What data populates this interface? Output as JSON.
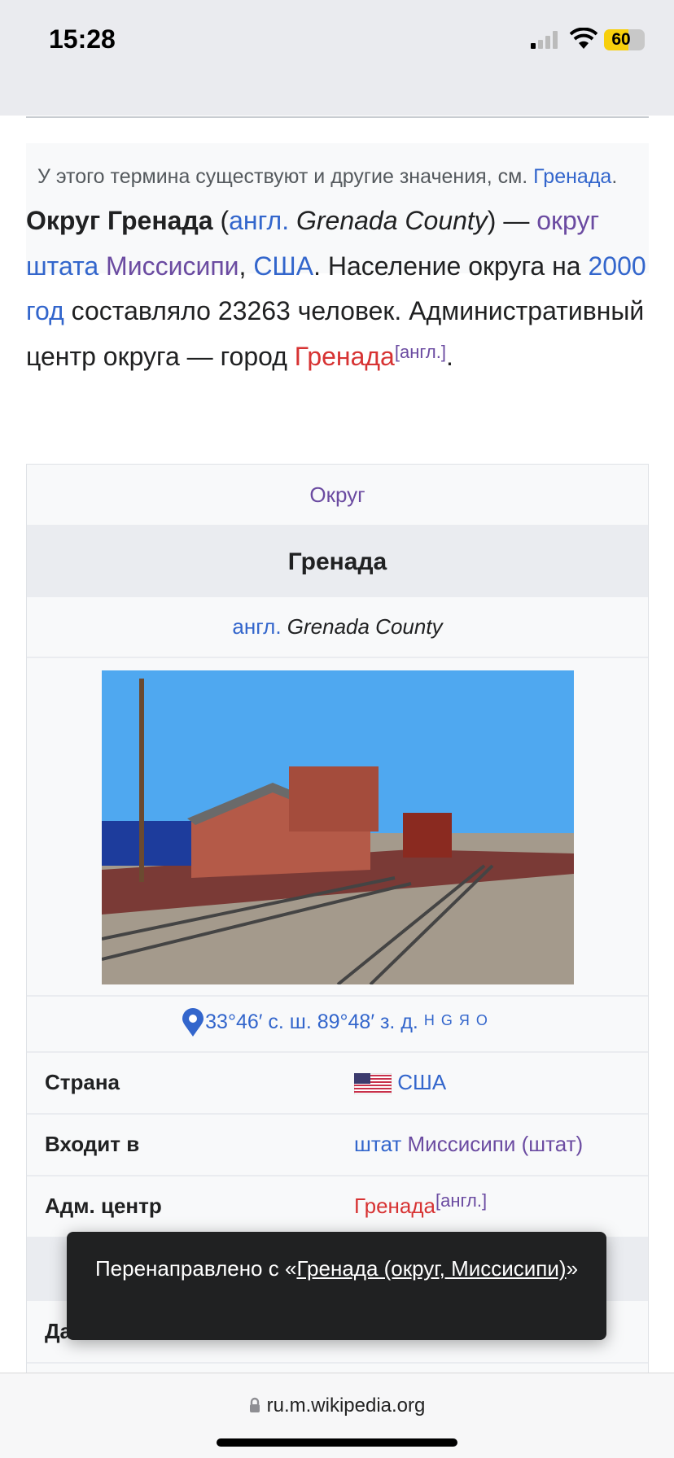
{
  "status": {
    "time": "15:28",
    "battery": "60"
  },
  "hatnote": {
    "text": "У этого термина существуют и другие значения, см. ",
    "link": "Гренада",
    "end": "."
  },
  "lead": {
    "bold": "Округ Гренада",
    "p1": " (",
    "engl": "англ.",
    "english_name": " Grenada County",
    "p2": ") — ",
    "okrug": "округ",
    "shtata": "штата",
    "miss": "Миссисипи",
    "comma": ", ",
    "usa": "США",
    "p3": ". Население округа на ",
    "year": "2000 год",
    "p4": " составляло 23263 человек. Административный центр округа — город ",
    "city": "Гренада",
    "sup": "[англ.]",
    "end": "."
  },
  "infobox": {
    "type": "Округ",
    "title": "Гренада",
    "engl": "англ.",
    "english_name": "Grenada County",
    "coords": "33°46′ с. ш. 89°48′ з. д.",
    "coord_links": [
      "H",
      "G",
      "Я",
      "O"
    ],
    "rows": [
      {
        "label": "Страна",
        "value": "США",
        "icon": "us-flag-icon"
      },
      {
        "label": "Входит в",
        "value_a": "штат",
        "value_b": "Миссисипи (штат)"
      },
      {
        "label": "Адм. центр",
        "value": "Гренада",
        "sup": "[англ.]"
      },
      {
        "label": "Да"
      }
    ]
  },
  "toast": {
    "text": "Перенаправлено с «",
    "link": "Гренада (округ, Миссисипи)",
    "end": "»"
  },
  "browser": {
    "url": "ru.m.wikipedia.org"
  }
}
